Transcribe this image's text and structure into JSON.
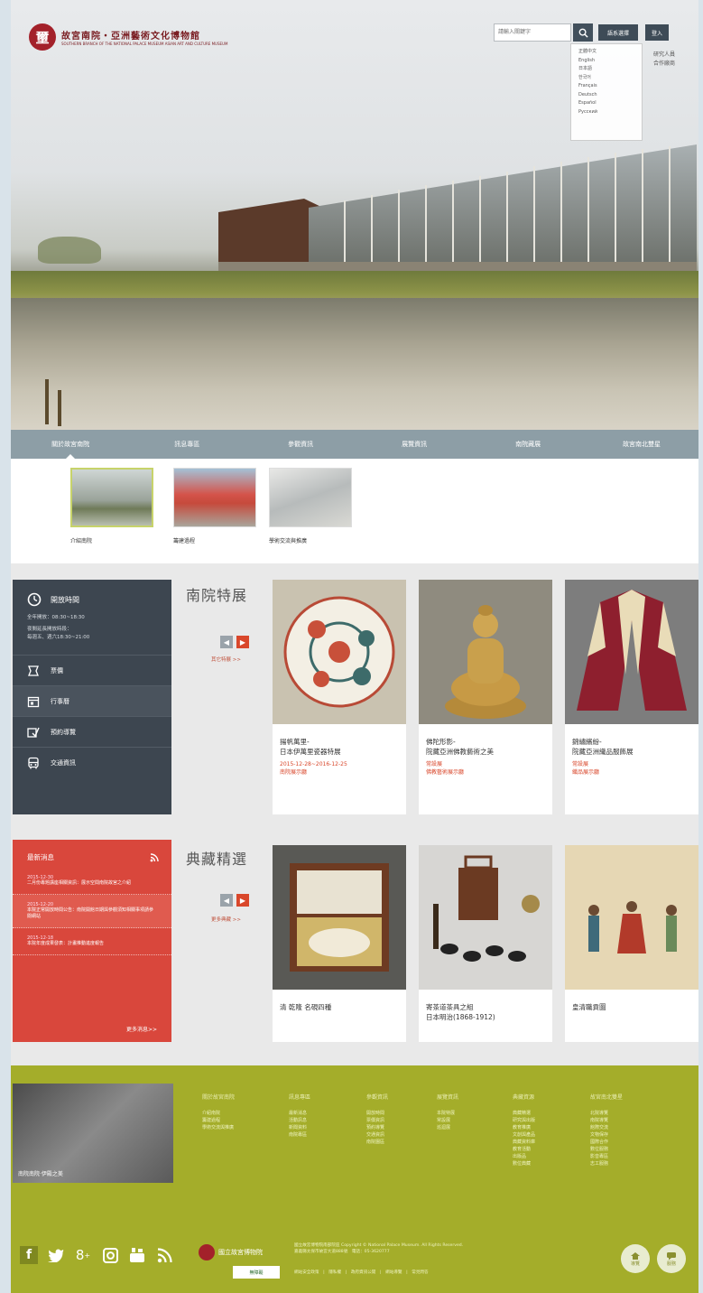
{
  "header": {
    "logo_mark": "壐",
    "logo_cn": "故宮南院‧亞洲藝術文化博物館",
    "logo_en": "SOUTHERN BRANCH OF THE NATIONAL PALACE MUSEUM ASIAN ART AND CULTURE MUSEUM",
    "search_placeholder": "請輸入關鍵字",
    "lang_label": "語系選擇",
    "login_label": "登入",
    "languages": [
      "正體中文",
      "English",
      "日本語",
      "한국어",
      "Français",
      "Deutsch",
      "Español",
      "Русский"
    ],
    "top_links": [
      "研究人員",
      "合作廠商"
    ]
  },
  "nav": {
    "items": [
      "關於故宮南院",
      "訊息專區",
      "參觀資訊",
      "展覽資訊",
      "南院藏展",
      "故宮南北雙星"
    ],
    "sub_items": [
      "介紹南院",
      "籌建過程",
      "學術交流與推廣"
    ]
  },
  "visit": {
    "title": "開放時間",
    "text_1": "全年開放：08:30~18:30",
    "text_2": "夜間延長開放時段：",
    "text_3": "每週五、週六18:30~21:00",
    "rows": [
      "票價",
      "行事曆",
      "預約導覽",
      "交通資訊"
    ]
  },
  "exhibitions": {
    "title": "南院特展",
    "more": "其它特展 >>",
    "cards": [
      {
        "title_1": "揚帆萬里-",
        "title_2": "日本伊萬里瓷器特展",
        "meta_1": "2015-12-28~2016-12-25",
        "meta_2": "南院展示廳"
      },
      {
        "title_1": "佛陀形影-",
        "title_2": "院藏亞洲佛教藝術之美",
        "meta_1": "常設展",
        "meta_2": "佛教藝術展示廳"
      },
      {
        "title_1": "錦繡繽紛-",
        "title_2": "院藏亞洲織品服飾展",
        "meta_1": "常設展",
        "meta_2": "織品展示廳"
      }
    ]
  },
  "news": {
    "title": "最新消息",
    "items": [
      {
        "date": "2015-12-30",
        "text": "二月份專題講座相關資訊：展示空間南院故宮之介紹"
      },
      {
        "date": "2015-12-20",
        "text": "本院正常開放時間公告：南院開館日期與參觀須知相關事項請參閱網站"
      },
      {
        "date": "2015-12-18",
        "text": "本院年度成果發表：計畫推動進度報告"
      }
    ],
    "more": "更多消息>>"
  },
  "collection": {
    "title": "典藏精選",
    "more": "更多典藏 >>",
    "cards": [
      {
        "title_1": "清 乾隆 名硯四種",
        "title_2": ""
      },
      {
        "title_1": "寄茶道茶具之組",
        "title_2": "日本明治(1868-1912)"
      },
      {
        "title_1": "皇清職貢圖",
        "title_2": ""
      }
    ]
  },
  "footer": {
    "promo_caption": "南院南院‧伊殿之美",
    "columns": [
      {
        "head": "關於故宮南院",
        "items": [
          "介紹南院",
          "籌建過程",
          "學術交流與推廣"
        ]
      },
      {
        "head": "訊息專區",
        "items": [
          "最新消息",
          "活動訊息",
          "新聞資料",
          "南院專區"
        ]
      },
      {
        "head": "參觀資訊",
        "items": [
          "開放時間",
          "票價資訊",
          "預約導覽",
          "交通資訊",
          "南院園區"
        ]
      },
      {
        "head": "展覽資訊",
        "items": [
          "本院特展",
          "常設展",
          "巡迴展"
        ]
      },
      {
        "head": "典藏資源",
        "items": [
          "典藏精選",
          "研究與出版",
          "教育推廣",
          "文創與產品",
          "典藏資料庫",
          "教育活動",
          "出版品",
          "數位典藏"
        ]
      },
      {
        "head": "故宮南北雙星",
        "items": [
          "北院導覽",
          "南院導覽",
          "館際交流",
          "文物保存",
          "國際合作",
          "數位服務",
          "影音專區",
          "志工服務"
        ]
      }
    ],
    "museum_name": "國立故宮博物院",
    "copyright_1": "國立故宮博物院南部院區 Copyright © National Palace Museum. All Rights Reserved.",
    "copyright_2": "嘉義縣太保市故宮大道888號　電話：05-3620777",
    "badge": "無障礙",
    "links": "網站安全政策　|　隱私權　|　政府資訊公開　|　網站導覽　|　常見問答",
    "round_1": "導覽",
    "round_2": "服務"
  }
}
